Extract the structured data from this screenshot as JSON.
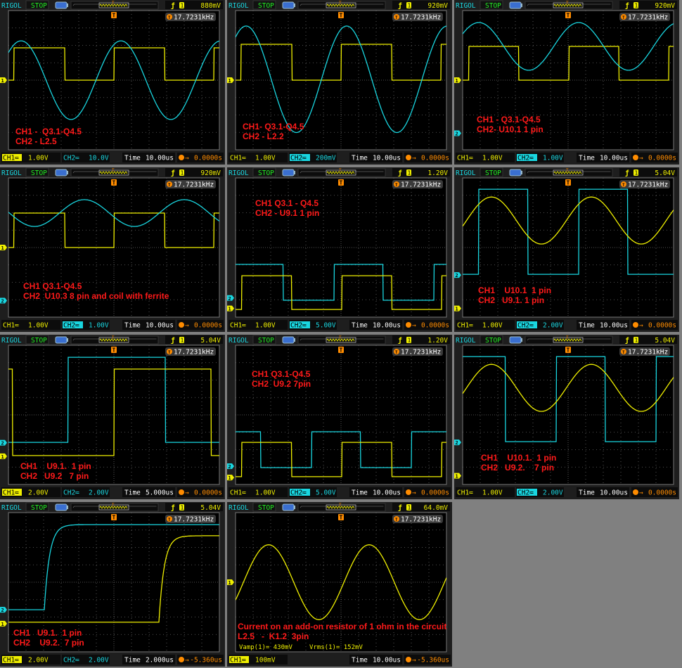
{
  "header": {
    "brand": "RIGOL",
    "state": "STOP",
    "freq_label": "17.7231kHz",
    "trigger_channel": "1"
  },
  "colors": {
    "ch1": "#f0f000",
    "ch2": "#19d6e0",
    "caption": "#ff1a1a",
    "trigger": "#ff8c00",
    "status": "#22ee22"
  },
  "panels": [
    {
      "trig_level": "880mV",
      "active": "ch1",
      "ch1_scale": "1.00V",
      "ch2_scale": "10.0V",
      "time": "10.00us",
      "offset": "0.0000s",
      "caption": [
        "CH1 -  Q3.1-Q4.5",
        "CH2 - L2.5"
      ],
      "markers": {
        "ch1": 0
      },
      "traces": [
        {
          "ch": "ch1",
          "kind": "square",
          "period": 5.68,
          "rise": 0.32,
          "duty": 0.51,
          "hi": 1.86,
          "lo": 0
        },
        {
          "ch": "ch2",
          "kind": "sine",
          "period": 5.68,
          "peak": 0.72,
          "amp": 2.26,
          "offset": 0
        }
      ]
    },
    {
      "trig_level": "920mV",
      "active": "ch2",
      "ch1_scale": "1.00V",
      "ch2_scale": "200mV",
      "time": "10.00us",
      "offset": "0.0000s",
      "caption": [
        "CH1- Q3.1-Q4.5",
        "CH2 - L2.2"
      ],
      "markers": {
        "ch1": 0
      },
      "traces": [
        {
          "ch": "ch1",
          "kind": "square",
          "period": 5.68,
          "rise": 0.32,
          "duty": 0.51,
          "hi": 2.06,
          "lo": 0
        },
        {
          "ch": "ch2",
          "kind": "sine",
          "period": 5.72,
          "peak": 0.6,
          "amp": 3.06,
          "offset": 0.05
        }
      ]
    },
    {
      "trig_level": "920mV",
      "active": "ch2",
      "ch1_scale": "1.00V",
      "ch2_scale": "1.00V",
      "time": "10.00us",
      "offset": "0.0000s",
      "caption": [
        "CH1 - Q3.1-Q4.5",
        "CH2- U10.1 1 pin"
      ],
      "markers": {
        "ch1": 0,
        "ch2": -3.05
      },
      "traces": [
        {
          "ch": "ch1",
          "kind": "square",
          "period": 5.68,
          "rise": 0.36,
          "duty": 0.5,
          "hi": 1.94,
          "lo": 0
        },
        {
          "ch": "ch2",
          "kind": "sine",
          "period": 5.68,
          "peak": 0.92,
          "amp": 1.37,
          "offset": 1.94
        }
      ]
    },
    {
      "trig_level": "920mV",
      "active": "ch2",
      "ch1_scale": "1.00V",
      "ch2_scale": "1.00V",
      "time": "10.00us",
      "offset": "0.0000s",
      "caption": [
        "CH1 Q3.1-Q4.5",
        "CH2  U10.3 8 pin and coil with ferrite"
      ],
      "markers": {
        "ch1": 0,
        "ch2": -3.05
      },
      "traces": [
        {
          "ch": "ch1",
          "kind": "square",
          "period": 5.68,
          "rise": 0.32,
          "duty": 0.51,
          "hi": 1.98,
          "lo": 0
        },
        {
          "ch": "ch2",
          "kind": "sine",
          "period": 5.68,
          "peak": 4.32,
          "amp": 0.77,
          "offset": 1.98
        }
      ]
    },
    {
      "trig_level": "1.20V",
      "active": "ch2",
      "ch1_scale": "1.00V",
      "ch2_scale": "5.00V",
      "time": "10.00us",
      "offset": "0.0000s",
      "caption": [
        "CH1 Q3.1 - Q4.5",
        "CH2 - U9.1 1 pin"
      ],
      "markers": {
        "ch1": -3.5,
        "ch2": -2.9
      },
      "traces": [
        {
          "ch": "ch2",
          "kind": "square",
          "period": 5.68,
          "rise": -0.08,
          "duty": 0.49,
          "hi": -0.97,
          "lo": -3.03
        },
        {
          "ch": "ch1",
          "kind": "square",
          "period": 5.68,
          "rise": 0.36,
          "duty": 0.5,
          "hi": -1.62,
          "lo": -3.56
        }
      ]
    },
    {
      "trig_level": "5.04V",
      "active": "ch2",
      "ch1_scale": "1.00V",
      "ch2_scale": "2.00V",
      "time": "10.00us",
      "offset": "0.0000s",
      "caption": [
        "CH1    U10.1  1 pin",
        "CH2   U9.1. 1 pin"
      ],
      "markers": {
        "ch1": -3.5,
        "ch2": -1.58
      },
      "traces": [
        {
          "ch": "ch2",
          "kind": "square",
          "period": 5.68,
          "rise": 0.92,
          "duty": 0.49,
          "hi": 3.35,
          "lo": -1.54
        },
        {
          "ch": "ch1",
          "kind": "sine",
          "period": 5.68,
          "peak": 1.64,
          "amp": 1.35,
          "offset": 1.55
        }
      ]
    },
    {
      "trig_level": "5.04V",
      "active": "ch1",
      "ch1_scale": "2.00V",
      "ch2_scale": "2.00V",
      "time": "5.000us",
      "offset": "0.0000s",
      "caption": [
        "CH1    U9.1.  1 pin",
        "CH2   U9.2   7 pin"
      ],
      "markers": {
        "ch1": -2.38,
        "ch2": -1.6
      },
      "traces": [
        {
          "ch": "ch2",
          "kind": "square",
          "period": 11.3,
          "rise": 3.4,
          "duty": 0.49,
          "hi": 3.31,
          "lo": -1.58
        },
        {
          "ch": "ch1",
          "kind": "square",
          "period": 11.3,
          "rise": 6.0,
          "duty": 0.49,
          "hi": 2.63,
          "lo": -2.34
        }
      ]
    },
    {
      "trig_level": "1.20V",
      "active": "ch2",
      "ch1_scale": "1.00V",
      "ch2_scale": "5.00V",
      "time": "10.00us",
      "offset": "0.0000s",
      "caption": [
        "CH1 Q3.1-Q4.5",
        "CH2  U9.2 7pin"
      ],
      "markers": {
        "ch1": -3.6,
        "ch2": -2.95
      },
      "traces": [
        {
          "ch": "ch2",
          "kind": "square",
          "period": 5.68,
          "rise": -1.36,
          "duty": 0.49,
          "hi": -0.97,
          "lo": -3.03
        },
        {
          "ch": "ch1",
          "kind": "square",
          "period": 5.68,
          "rise": 0.36,
          "duty": 0.5,
          "hi": -1.58,
          "lo": -3.55
        }
      ]
    },
    {
      "trig_level": "5.04V",
      "active": "ch2",
      "ch1_scale": "1.00V",
      "ch2_scale": "2.00V",
      "time": "10.00us",
      "offset": "0.0000s",
      "caption": [
        "CH1    U10.1.  1 pin",
        "CH2   U9.2.    7 pin"
      ],
      "markers": {
        "ch1": -3.5,
        "ch2": -1.58
      },
      "traces": [
        {
          "ch": "ch2",
          "kind": "square",
          "period": 5.68,
          "rise": -0.36,
          "duty": 0.49,
          "hi": 3.35,
          "lo": -1.54
        },
        {
          "ch": "ch1",
          "kind": "sine",
          "period": 5.68,
          "peak": 1.64,
          "amp": 1.35,
          "offset": 1.55
        }
      ]
    },
    {
      "trig_level": "5.04V",
      "active": "ch1",
      "ch1_scale": "2.00V",
      "ch2_scale": "2.00V",
      "time": "2.000us",
      "offset": "-5.360us",
      "caption": [
        "CH1   U9.1.  1 pin",
        "CH2    U9.2.  7 pin"
      ],
      "markers": {
        "ch1": -2.38,
        "ch2": -1.58
      },
      "traces": [
        {
          "ch": "ch2",
          "kind": "step",
          "at": 2.04,
          "tau": 0.3,
          "hi": 3.31,
          "lo": -1.58
        },
        {
          "ch": "ch1",
          "kind": "step",
          "at": 8.56,
          "tau": 0.3,
          "hi": 2.67,
          "lo": -2.3
        }
      ]
    },
    {
      "trig_level": "64.0mV",
      "active": "ch1",
      "ch1_scale": "100mV",
      "time": "10.00us",
      "offset": "-5.360us",
      "caption": [
        "Current on an add-on resistor of 1 ohm in the circuit",
        "L2.5   -  K1.2  3pin"
      ],
      "measurements": [
        "Vamp(1)= 430mV",
        "Vrms(1)= 152mV"
      ],
      "markers": {
        "ch1": 0
      },
      "traces": [
        {
          "ch": "ch1",
          "kind": "sine",
          "period": 5.72,
          "peak": 1.88,
          "amp": 2.15,
          "offset": 0
        }
      ]
    }
  ]
}
